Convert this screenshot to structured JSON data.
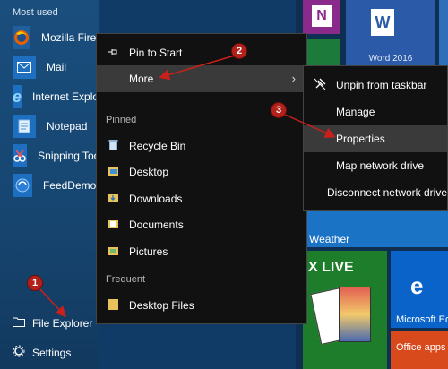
{
  "start": {
    "section_title": "Most used",
    "apps": [
      {
        "label": "Mozilla Firefox",
        "tile_color": "#1f5f9e",
        "icon": "firefox-icon"
      },
      {
        "label": "Mail",
        "tile_color": "#1f6fc0",
        "icon": "mail-icon"
      },
      {
        "label": "Internet Explorer",
        "tile_color": "#1f6fc0",
        "icon": "internet-explorer-icon"
      },
      {
        "label": "Notepad",
        "tile_color": "#1f6fc0",
        "icon": "notepad-icon"
      },
      {
        "label": "Snipping Tool",
        "tile_color": "#1f6fc0",
        "icon": "snipping-tool-icon"
      },
      {
        "label": "FeedDemon",
        "tile_color": "#1f6fc0",
        "icon": "feeddemon-icon"
      }
    ],
    "file_explorer": "File Explorer",
    "settings": "Settings"
  },
  "context_menu": {
    "pin_to_start": "Pin to Start",
    "more": "More",
    "pinned_heading": "Pinned",
    "pinned": [
      "Recycle Bin",
      "Desktop",
      "Downloads",
      "Documents",
      "Pictures"
    ],
    "frequent_heading": "Frequent",
    "frequent": [
      "Desktop Files"
    ]
  },
  "submenu": {
    "items": [
      "Unpin from taskbar",
      "Manage",
      "Properties",
      "Map network drive",
      "Disconnect network drive"
    ]
  },
  "tiles": {
    "word_caption": "Word 2016",
    "weather": "Weather",
    "xbox_live": "X LIVE",
    "edge": "Microsoft Ed",
    "office": "Office apps"
  },
  "annotations": {
    "step1": "1",
    "step2": "2",
    "step3": "3"
  },
  "colors": {
    "annotation": "#c8201a",
    "menu_bg": "#111111",
    "start_bg": "#164570"
  }
}
